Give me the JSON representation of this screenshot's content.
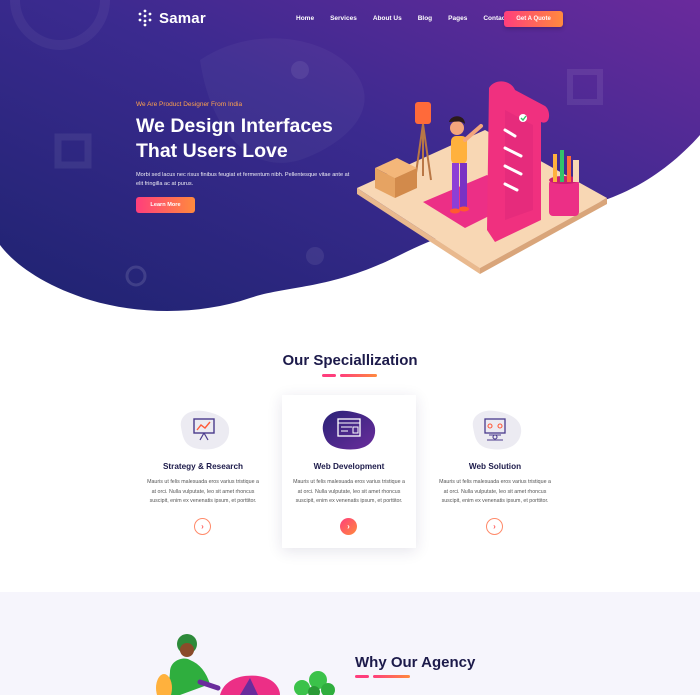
{
  "brand": {
    "name": "Samar"
  },
  "nav": {
    "items": [
      "Home",
      "Services",
      "About Us",
      "Blog",
      "Pages",
      "Contact Us"
    ],
    "cta": "Get A Quote"
  },
  "hero": {
    "tagline": "We Are Product Designer From India",
    "headline": "We Design Interfaces That Users Love",
    "description": "Morbi sed lacus nec risus finibus feugiat et fermentum nibh. Pellentesque vitae ante at elit fringilla ac at purus.",
    "button": "Learn More"
  },
  "specialization": {
    "title": "Our Speciallization",
    "cards": [
      {
        "title": "Strategy & Research",
        "text": "Mauris ut felis malesuada eros varius tristique a at orci. Nulla vulputate, leo sit amet rhoncus suscipit, enim ex venenatis ipsum, et porttitor.",
        "arrow": "›",
        "icon": "presentation-chart-icon"
      },
      {
        "title": "Web Development",
        "text": "Mauris ut felis malesuada eros varius tristique a at orci. Nulla vulputate, leo sit amet rhoncus suscipit, enim ex venenatis ipsum, et porttitor.",
        "arrow": "›",
        "icon": "browser-code-icon"
      },
      {
        "title": "Web Solution",
        "text": "Mauris ut felis malesuada eros varius tristique a at orci. Nulla vulputate, leo sit amet rhoncus suscipit, enim ex venenatis ipsum, et porttitor.",
        "arrow": "›",
        "icon": "team-network-icon"
      }
    ]
  },
  "why": {
    "title": "Why Our Agency"
  },
  "colors": {
    "hero_dark": "#2a1f78",
    "hero_light": "#6a2fa0",
    "accent_start": "#ff3e7c",
    "accent_end": "#ff8a3d",
    "tagline": "#ffa24d",
    "heading": "#1c1a4a"
  }
}
